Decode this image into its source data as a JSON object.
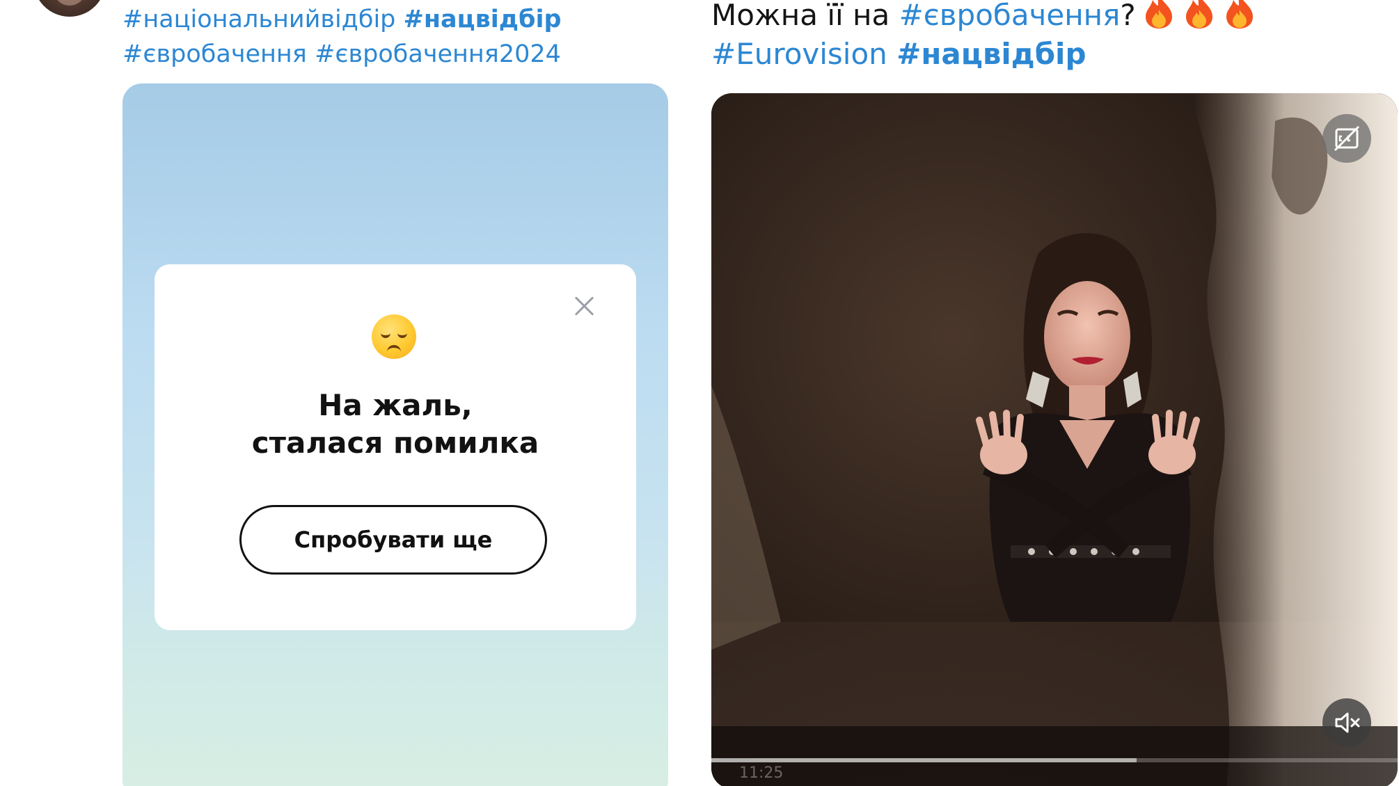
{
  "left_post": {
    "hashtags_line1": [
      "#національнийвідбір",
      "#нацвідбір"
    ],
    "hashtags_line2": [
      "#євробачення",
      "#євробачення2024"
    ],
    "error_card": {
      "emoji": "😞",
      "title_line1": "На жаль,",
      "title_line2": "сталася помилка",
      "retry_label": "Спробувати ще"
    }
  },
  "right_post": {
    "text_prefix": "Можна її на ",
    "hashtag1": "#євробачення",
    "text_suffix": "?",
    "fire_count": 3,
    "hashtag2": "#Eurovision",
    "hashtag3": "#нацвідбір",
    "video": {
      "timestamp": "11:25",
      "progress": 0.62
    }
  },
  "colors": {
    "hashtag": "#2c87d3",
    "text": "#141414"
  },
  "icons": {
    "close": "close-icon",
    "captions": "captions-off-icon",
    "mute": "volume-muted-icon",
    "fire": "fire-emoji-icon"
  }
}
